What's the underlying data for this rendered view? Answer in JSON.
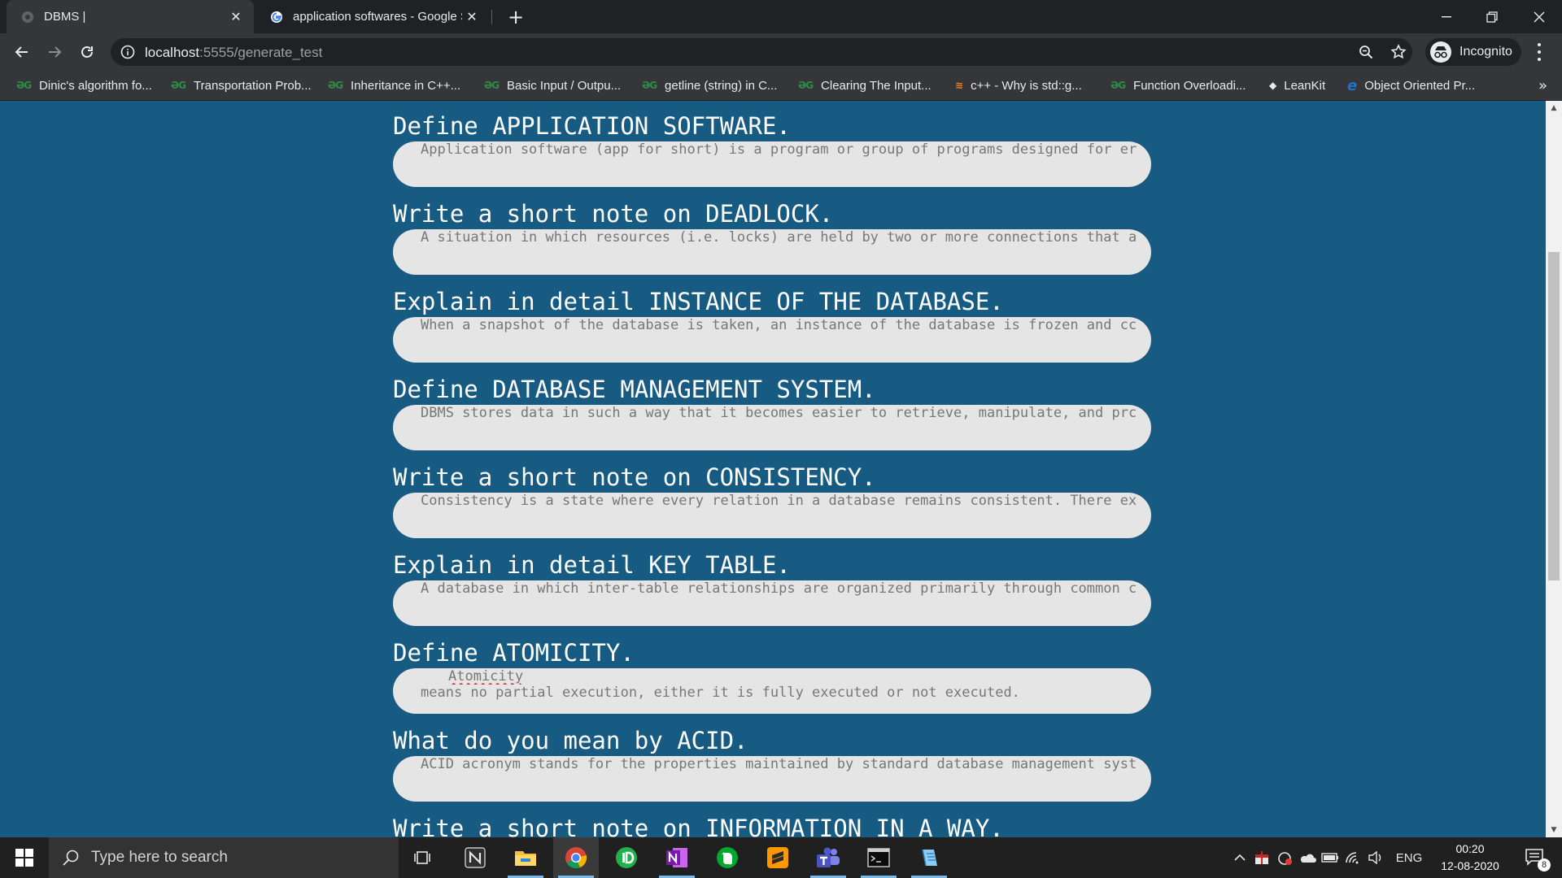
{
  "browser": {
    "tabs": [
      {
        "title": "DBMS |",
        "active": true
      },
      {
        "title": "application softwares - Google Se",
        "active": false
      }
    ],
    "url_host": "localhost",
    "url_path": ":5555/generate_test",
    "profile_label": "Incognito",
    "bookmarks": [
      {
        "label": "Dinic's algorithm fo...",
        "icon": "gfg-icon"
      },
      {
        "label": "Transportation Prob...",
        "icon": "gfg-icon"
      },
      {
        "label": "Inheritance in C++...",
        "icon": "gfg-icon"
      },
      {
        "label": "Basic Input / Outpu...",
        "icon": "gfg-icon"
      },
      {
        "label": "getline (string) in C...",
        "icon": "gfg-icon"
      },
      {
        "label": "Clearing The Input...",
        "icon": "gfg-icon"
      },
      {
        "label": "c++ - Why is std::g...",
        "icon": "stackoverflow-icon"
      },
      {
        "label": "Function Overloadi...",
        "icon": "gfg-icon"
      },
      {
        "label": "LeanKit",
        "icon": "leankit-icon"
      },
      {
        "label": "Object Oriented Pr...",
        "icon": "ie-icon"
      }
    ],
    "bookmarks_overflow": "»"
  },
  "questions": [
    {
      "question": "Define APPLICATION SOFTWARE.",
      "answer": "Application software (app for short) is a program or group of programs designed for er"
    },
    {
      "question": "Write a short note on DEADLOCK.",
      "answer": "A situation in which resources (i.e. locks) are held by two or more connections that a"
    },
    {
      "question": "Explain in detail INSTANCE OF THE DATABASE.",
      "answer": "When a snapshot of the database is taken, an instance of the database is frozen and cc"
    },
    {
      "question": "Define DATABASE MANAGEMENT SYSTEM.",
      "answer": "DBMS stores data in such a way that it becomes easier to retrieve, manipulate, and prc"
    },
    {
      "question": "Write a short note on CONSISTENCY.",
      "answer": "Consistency is a state where every relation in a database remains consistent. There ex"
    },
    {
      "question": "Explain in detail KEY TABLE.",
      "answer": "A database in which inter-table relationships are organized primarily through common c"
    },
    {
      "question": "Define ATOMICITY.",
      "answer_word": "Atomicity",
      "answer_rest": " means no partial execution, either it is fully executed or not executed."
    },
    {
      "question": "What do you mean by ACID.",
      "answer": "ACID acronym stands for the properties maintained by standard database management syst"
    },
    {
      "question": "Write a short note on INFORMATION IN A WAY.",
      "answer": ""
    }
  ],
  "taskbar": {
    "search_placeholder": "Type here to search",
    "language": "ENG",
    "time": "00:20",
    "date": "12-08-2020",
    "notification_count": "8",
    "apps": [
      "task-view-icon",
      "notion-icon",
      "file-explorer-icon",
      "chrome-icon",
      "intellij-icon",
      "onenote-icon",
      "evernote-icon",
      "sublime-text-icon",
      "teams-icon",
      "terminal-icon",
      "notepad-icon"
    ]
  },
  "colors": {
    "page_background": "#175a82",
    "answer_pill": "#e5e5e5",
    "question_text": "#ffffff",
    "answer_text": "#777777"
  }
}
